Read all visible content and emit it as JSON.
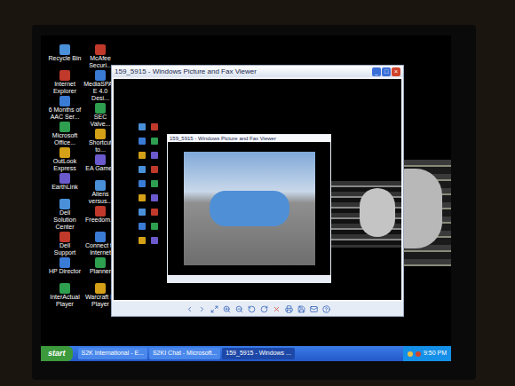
{
  "desktop": {
    "columns": [
      [
        {
          "label": "Recycle Bin"
        },
        {
          "label": "Internet Explorer"
        },
        {
          "label": "6 Months of AAC Ser..."
        },
        {
          "label": "Microsoft Office..."
        },
        {
          "label": "OutLook Express"
        },
        {
          "label": "EarthLink"
        },
        {
          "label": "Dell Solution Center"
        },
        {
          "label": "Dell Support"
        },
        {
          "label": "HP Director"
        },
        {
          "label": "InterActual Player"
        }
      ],
      [
        {
          "label": "McAfee Securi..."
        },
        {
          "label": "MediaSPACE 4.0 Desi..."
        },
        {
          "label": "SEC Valve..."
        },
        {
          "label": "Shortcut to..."
        },
        {
          "label": "EA Games"
        },
        {
          "label": "Aliens versus..."
        },
        {
          "label": "Freedom..."
        },
        {
          "label": "Connect to Internet"
        },
        {
          "label": "Planner"
        },
        {
          "label": "Warcraft III Player"
        }
      ]
    ]
  },
  "window": {
    "title": "159_5915 - Windows Picture and Fax Viewer",
    "controls": [
      "_",
      "□",
      "×"
    ]
  },
  "nested_window": {
    "title": "159_5915 - Windows Picture and Fax Viewer"
  },
  "taskbar": {
    "start": "start",
    "tasks": [
      {
        "label": "S2K International - E...",
        "selected": false
      },
      {
        "label": "S2KI Chat - Microsoft...",
        "selected": false
      },
      {
        "label": "159_5915 - Windows ...",
        "selected": true
      }
    ],
    "clock": "9:50 PM"
  }
}
